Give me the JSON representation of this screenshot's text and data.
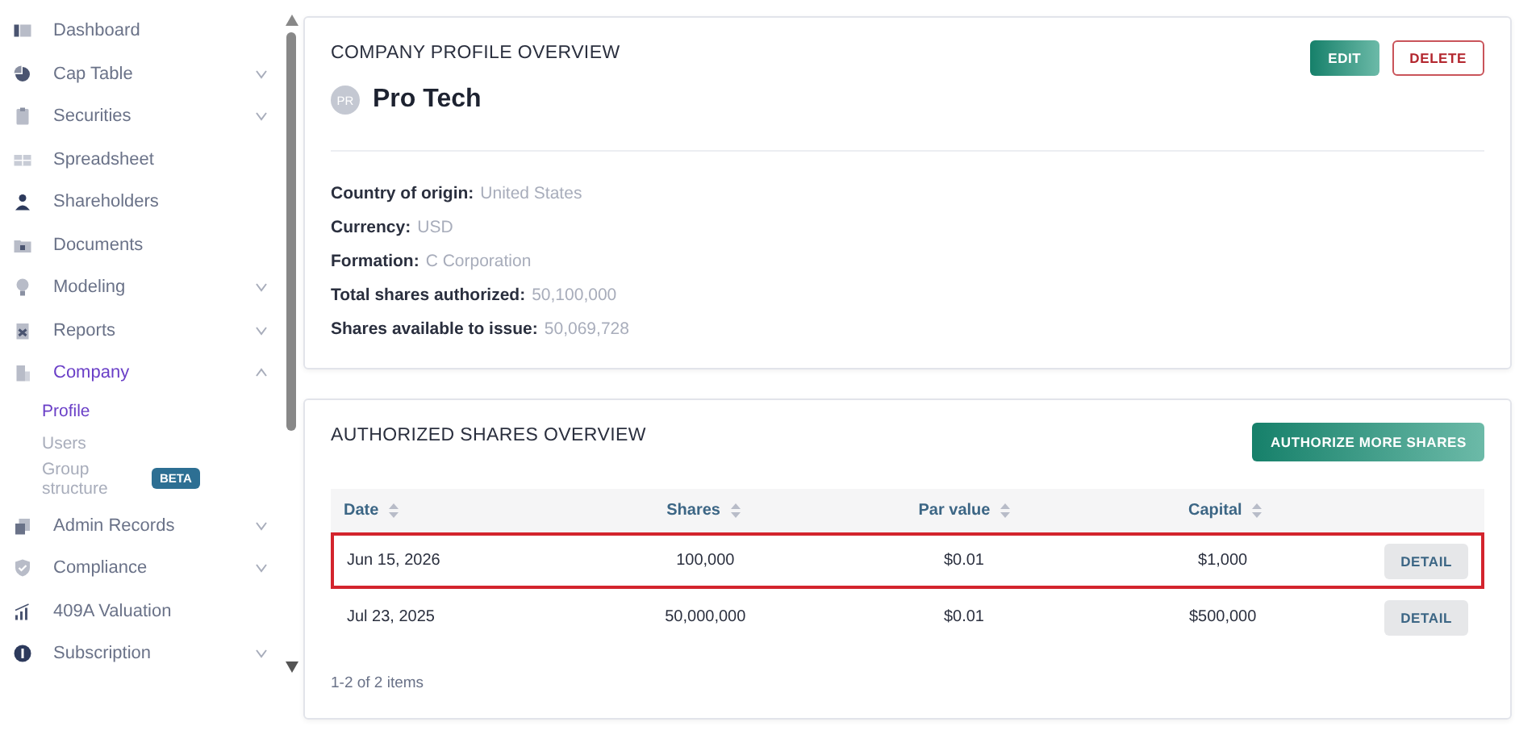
{
  "sidebar": {
    "items": [
      {
        "label": "Dashboard",
        "selected": false
      },
      {
        "label": "Cap Table",
        "selected": false,
        "expanded": false
      },
      {
        "label": "Securities",
        "selected": false,
        "expanded": false
      },
      {
        "label": "Spreadsheet",
        "selected": false
      },
      {
        "label": "Shareholders",
        "selected": false
      },
      {
        "label": "Documents",
        "selected": false
      },
      {
        "label": "Modeling",
        "selected": false,
        "expanded": false
      },
      {
        "label": "Reports",
        "selected": false,
        "expanded": false
      },
      {
        "label": "Company",
        "selected": true,
        "expanded": true,
        "children": [
          {
            "label": "Profile",
            "selected": true
          },
          {
            "label": "Users",
            "selected": false
          },
          {
            "label": "Group structure",
            "selected": false,
            "badge": "BETA"
          }
        ]
      },
      {
        "label": "Admin Records",
        "selected": false,
        "expanded": false
      },
      {
        "label": "Compliance",
        "selected": false,
        "expanded": false
      },
      {
        "label": "409A Valuation",
        "selected": false
      },
      {
        "label": "Subscription",
        "selected": false,
        "expanded": false
      }
    ]
  },
  "profile": {
    "title": "COMPANY PROFILE OVERVIEW",
    "buttons": [
      {
        "label": "EDIT",
        "kind": "primary"
      },
      {
        "label": "DELETE",
        "kind": "danger"
      }
    ],
    "avatar": "PR",
    "name": "Pro Tech",
    "fields": [
      {
        "label": "Country of origin:",
        "value": "United States"
      },
      {
        "label": "Currency:",
        "value": "USD"
      },
      {
        "label": "Formation:",
        "value": "C Corporation"
      },
      {
        "label": "Total shares authorized:",
        "value": "50,100,000"
      },
      {
        "label": "Shares available to issue:",
        "value": "50,069,728"
      }
    ]
  },
  "shares": {
    "title": "AUTHORIZED SHARES OVERVIEW",
    "button": "AUTHORIZE MORE SHARES",
    "columns": [
      "Date",
      "Shares",
      "Par value",
      "Capital"
    ],
    "rows": [
      {
        "cells": [
          "Jun 15, 2026",
          "100,000",
          "$0.01",
          "$1,000"
        ],
        "action": "DETAIL",
        "highlighted": true
      },
      {
        "cells": [
          "Jul 23, 2025",
          "50,000,000",
          "$0.01",
          "$500,000"
        ],
        "action": "DETAIL",
        "highlighted": false
      }
    ],
    "footer": "1-2 of 2 items"
  }
}
